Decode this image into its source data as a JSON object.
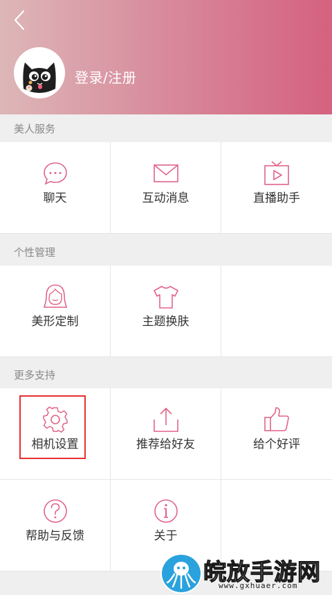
{
  "header": {
    "login_label": "登录/注册"
  },
  "sections": [
    {
      "title": "美人服务",
      "items": [
        {
          "label": "聊天",
          "icon": "chat-bubble-icon"
        },
        {
          "label": "互动消息",
          "icon": "envelope-icon"
        },
        {
          "label": "直播助手",
          "icon": "tv-play-icon"
        }
      ]
    },
    {
      "title": "个性管理",
      "items": [
        {
          "label": "美形定制",
          "icon": "face-icon"
        },
        {
          "label": "主题换肤",
          "icon": "tshirt-icon"
        }
      ]
    },
    {
      "title": "更多支持",
      "items": [
        {
          "label": "相机设置",
          "icon": "gear-icon"
        },
        {
          "label": "推荐给好友",
          "icon": "share-upload-icon"
        },
        {
          "label": "给个好评",
          "icon": "thumbs-up-icon"
        },
        {
          "label": "帮助与反馈",
          "icon": "help-circle-icon"
        },
        {
          "label": "关于",
          "icon": "info-circle-icon"
        }
      ]
    }
  ],
  "watermark": {
    "title": "皖放手游网",
    "url": "www.gxhuaer.com"
  },
  "colors": {
    "accent": "#e06489",
    "highlight": "#e53030",
    "header_start": "#ddb7b8",
    "header_end": "#d5617f"
  }
}
